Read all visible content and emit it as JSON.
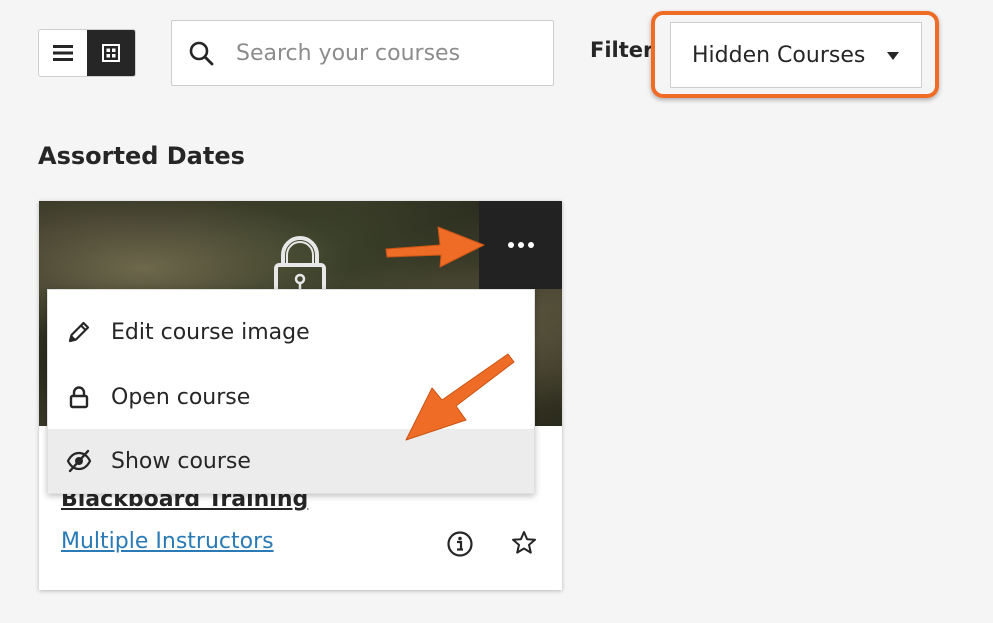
{
  "toolbar": {
    "view_toggle": {
      "list_icon": "list-view-icon",
      "grid_icon": "grid-view-icon",
      "active": "grid"
    },
    "search": {
      "placeholder": "Search your courses",
      "value": ""
    },
    "filter": {
      "label": "Filter",
      "selected": "Hidden Courses"
    }
  },
  "section": {
    "title": "Assorted Dates"
  },
  "course_card": {
    "title": "Blackboard Training",
    "instructors": "Multiple Instructors",
    "image_icon": "lock-icon",
    "more_icon": "more-options-icon"
  },
  "context_menu": {
    "items": [
      {
        "label": "Edit course image",
        "icon": "pencil-icon"
      },
      {
        "label": "Open course",
        "icon": "lock-icon"
      },
      {
        "label": "Show course",
        "icon": "eye-slash-icon"
      }
    ],
    "hovered_index": 2
  },
  "colors": {
    "annotation_orange": "#ef6c26",
    "link_blue": "#2a7ab6",
    "text_dark": "#262626"
  }
}
